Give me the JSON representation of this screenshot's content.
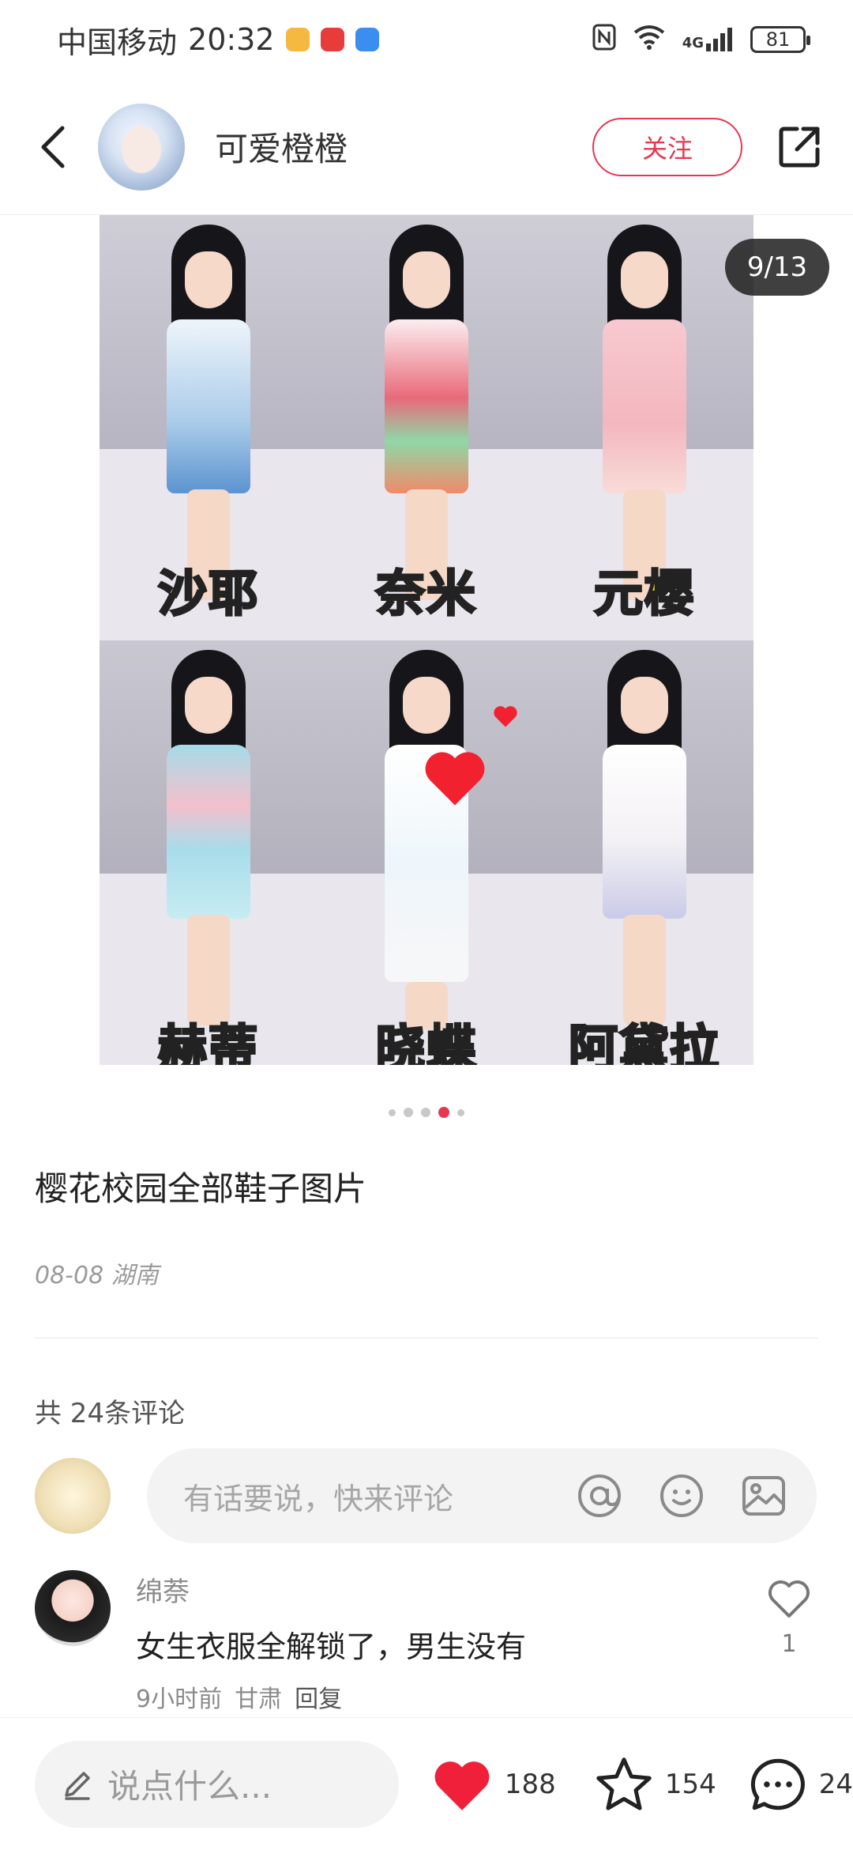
{
  "status_bar": {
    "carrier": "中国移动",
    "time": "20:32",
    "network": "4G",
    "battery": "81"
  },
  "header": {
    "author_name": "可爱橙橙",
    "follow_label": "关注"
  },
  "gallery": {
    "counter": "9/13",
    "characters": [
      "沙耶",
      "奈米",
      "元樱",
      "赫蒂",
      "晓蝶",
      "阿黛拉"
    ],
    "dots_total": 5,
    "dots_active_index": 3
  },
  "post": {
    "title": "樱花校园全部鞋子图片",
    "meta": "08-08 湖南"
  },
  "comments": {
    "count_label": "共 24条评论",
    "input_placeholder": "有话要说，快来评论",
    "items": [
      {
        "user": "绵萘",
        "text": "女生衣服全解锁了，男生没有",
        "time": "9小时前",
        "location": "甘肃",
        "reply_label": "回复",
        "likes": "1"
      }
    ]
  },
  "bottom_bar": {
    "placeholder": "说点什么...",
    "likes": "188",
    "favorites": "154",
    "comments": "24"
  },
  "colors": {
    "accent": "#e8364f",
    "label_yellow": "#ffe33a"
  }
}
